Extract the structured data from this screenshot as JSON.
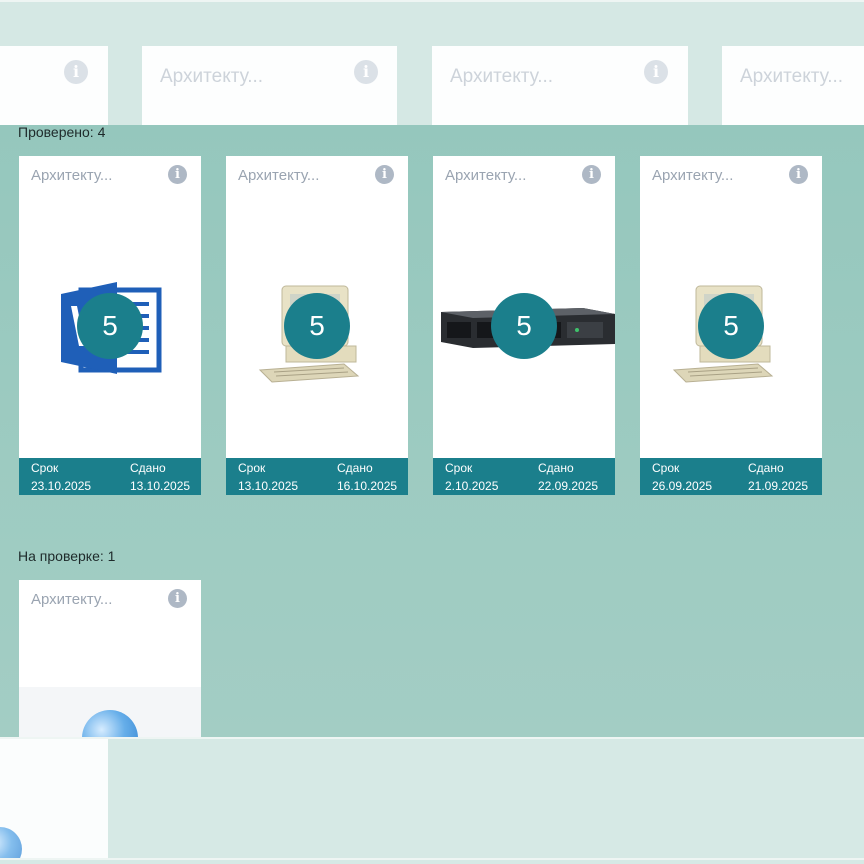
{
  "top_ghost_cards": [
    {
      "title": ""
    },
    {
      "title": "Архитекту..."
    },
    {
      "title": "Архитекту..."
    },
    {
      "title": "Архитекту..."
    }
  ],
  "sections": {
    "checked_label": "Проверено: 4",
    "review_label": "На проверке: 1"
  },
  "checked_cards": [
    {
      "title": "Архитекту...",
      "image": "word-document-icon",
      "grade": "5",
      "due_label": "Срок",
      "due": "23.10.2025",
      "submitted_label": "Сдано",
      "submitted": "13.10.2025"
    },
    {
      "title": "Архитекту...",
      "image": "retro-computer-icon",
      "grade": "5",
      "due_label": "Срок",
      "due": "13.10.2025",
      "submitted_label": "Сдано",
      "submitted": "16.10.2025"
    },
    {
      "title": "Архитекту...",
      "image": "rack-server-icon",
      "grade": "5",
      "due_label": "Срок",
      "due": "2.10.2025",
      "submitted_label": "Сдано",
      "submitted": "22.09.2025"
    },
    {
      "title": "Архитекту...",
      "image": "retro-computer-icon",
      "grade": "5",
      "due_label": "Срок",
      "due": "26.09.2025",
      "submitted_label": "Сдано",
      "submitted": "21.09.2025"
    }
  ],
  "review_cards": [
    {
      "title": "Архитекту...",
      "image": "globe-icon"
    }
  ],
  "colors": {
    "accent": "#1b7f8c",
    "background": "#9dcbc1"
  }
}
